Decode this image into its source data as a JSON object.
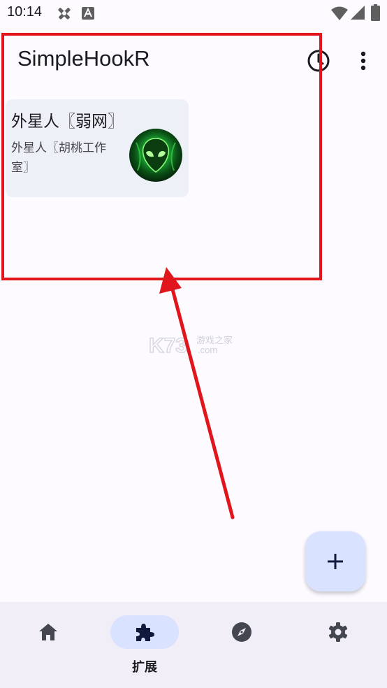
{
  "status_bar": {
    "time": "10:14",
    "icons": [
      "tools-icon",
      "font-icon",
      "wifi-icon",
      "signal-icon",
      "battery-icon"
    ]
  },
  "app_bar": {
    "title": "SimpleHookR",
    "actions": [
      "history-icon",
      "more-vert-icon"
    ]
  },
  "extension_card": {
    "title": "外星人〖弱网〗",
    "subtitle": "外星人〖胡桃工作室〗",
    "avatar": "alien-icon"
  },
  "watermark": {
    "logo": "K73",
    "text": "游戏之家",
    "domain": ".com"
  },
  "fab": {
    "icon": "plus-icon"
  },
  "bottom_nav": {
    "items": [
      {
        "icon": "home-icon",
        "label": ""
      },
      {
        "icon": "extension-icon",
        "label": "扩展",
        "selected": true
      },
      {
        "icon": "explore-icon",
        "label": ""
      },
      {
        "icon": "settings-icon",
        "label": ""
      }
    ]
  },
  "colors": {
    "background": "#fdfbff",
    "card": "#eef0f7",
    "accent_container": "#d9e2ff",
    "nav_background": "#f2eef7",
    "annotation_red": "#e0161c"
  }
}
